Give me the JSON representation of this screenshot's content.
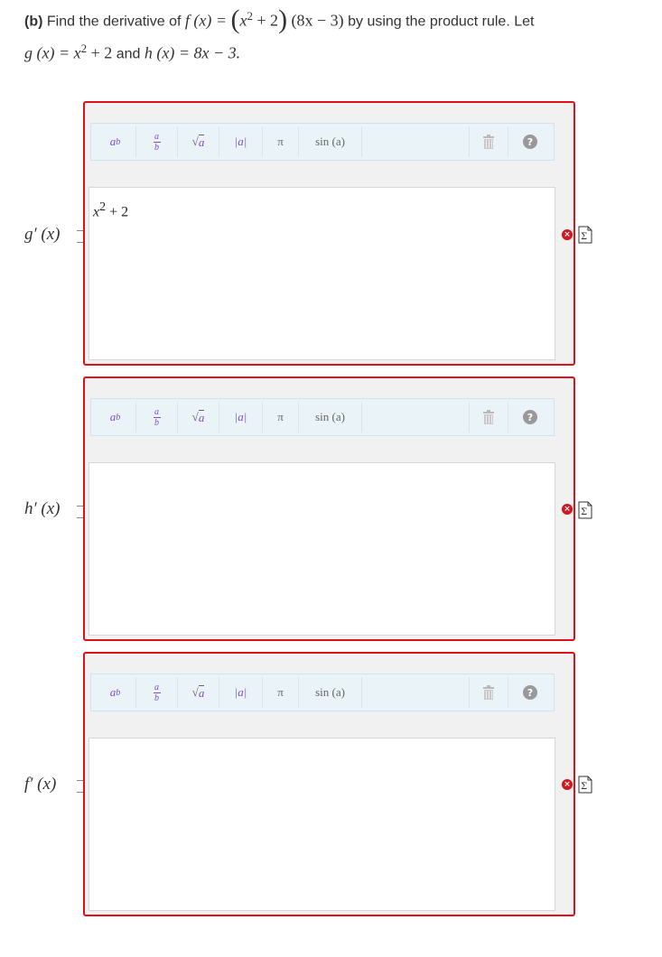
{
  "question": {
    "part": "(b)",
    "line1_text_a": "Find the derivative of",
    "line1_text_b": "by using the product rule. Let",
    "line2_text_a": "and",
    "f_def": "f (x) =",
    "f_expr_inner": "x",
    "f_expr_inner_tail": "+ 2",
    "f_expr_tail": "(8x − 3)",
    "g_def": "g (x) = x",
    "g_tail": "+ 2",
    "h_def": "h (x) = 8x − 3.",
    "exp": "2"
  },
  "toolbar": {
    "power_base": "a",
    "power_exp": "b",
    "frac_num": "a",
    "frac_den": "b",
    "sqrt_symbol": "√",
    "sqrt_arg": "a",
    "abs": "|a|",
    "pi": "π",
    "sin": "sin (a)",
    "trash_icon": "trash-icon",
    "help_icon": "help-icon",
    "help_glyph": "?"
  },
  "parts": [
    {
      "label": "g′ (x)",
      "value": "x",
      "value_exp": "2",
      "value_tail": " + 2"
    },
    {
      "label": "h′ (x)",
      "value": "",
      "value_exp": "",
      "value_tail": ""
    },
    {
      "label": "f′ (x)",
      "value": "",
      "value_exp": "",
      "value_tail": ""
    }
  ],
  "status": {
    "error_glyph": "×",
    "error_color": "#d0161f",
    "border_color": "#e0111b"
  }
}
